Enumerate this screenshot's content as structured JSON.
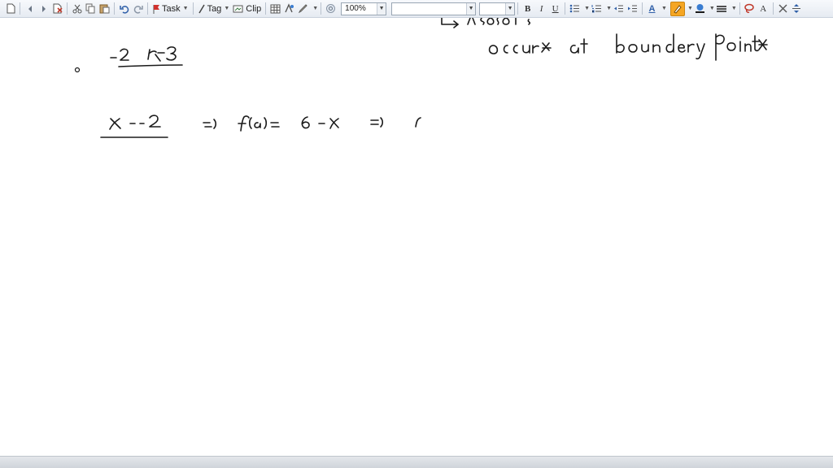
{
  "toolbar": {
    "task_label": "Task",
    "tag_label": "Tag",
    "clip_label": "Clip",
    "zoom_value": "100%",
    "font_name_value": "",
    "font_size_value": "",
    "bold_label": "B",
    "italic_label": "I",
    "underline_label": "U",
    "font_color_label": "A",
    "style_label": "A",
    "icons": [
      "new-page-icon",
      "back-icon",
      "forward-icon",
      "delete-page-icon",
      "cut-icon",
      "copy-icon",
      "paste-icon",
      "undo-icon",
      "redo-icon",
      "task-flag-icon",
      "tag-icon",
      "clip-icon",
      "table-icon",
      "insert-icon",
      "pen-icon",
      "at-icon",
      "bullets-icon",
      "numbering-icon",
      "outdent-icon",
      "indent-icon",
      "highlighter-icon",
      "fill-color-icon",
      "line-style-icon",
      "lasso-icon",
      "close-icon",
      "fit-icon"
    ]
  },
  "colors": {
    "highlighter": "#f5a623",
    "accent_red": "#c0392b",
    "ink": "#1a1a1a"
  }
}
